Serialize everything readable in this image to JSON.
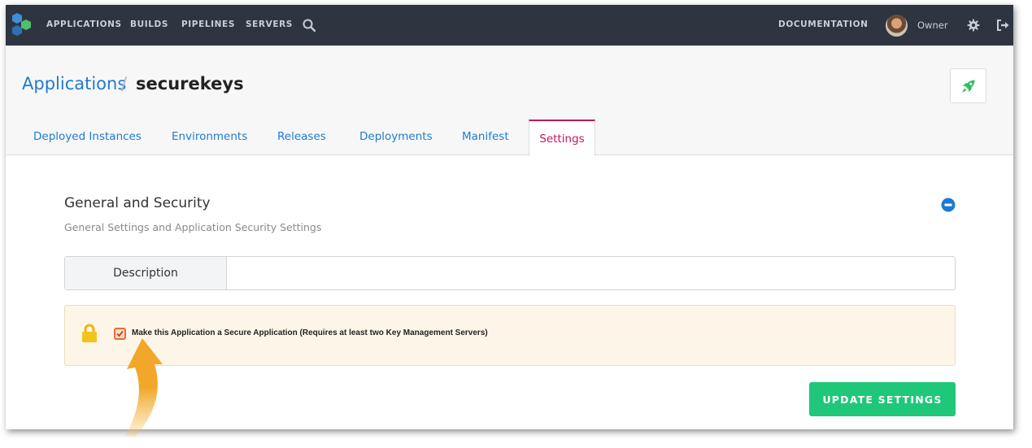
{
  "nav": {
    "items": [
      "APPLICATIONS",
      "BUILDS",
      "PIPELINES",
      "SERVERS"
    ],
    "documentation": "DOCUMENTATION",
    "user": "Owner"
  },
  "breadcrumb": {
    "parent": "Applications",
    "separator": "/",
    "current": "securekeys"
  },
  "tabs": [
    "Deployed Instances",
    "Environments",
    "Releases",
    "Deployments",
    "Manifest"
  ],
  "active_tab": "Settings",
  "section": {
    "title": "General and Security",
    "subtitle": "General Settings and Application Security Settings"
  },
  "form": {
    "description_label": "Description",
    "description_value": "",
    "secure_label": "Make this Application a Secure Application (Requires at least two Key Management Servers)",
    "secure_checked": true,
    "submit_label": "UPDATE SETTINGS"
  },
  "colors": {
    "nav_bg": "#2e3541",
    "link": "#1f7bd1",
    "active_tab": "#c2185b",
    "primary_button": "#1ec878",
    "notice_bg": "#fdf6e8",
    "annotation_arrow": "#f2a72a"
  }
}
